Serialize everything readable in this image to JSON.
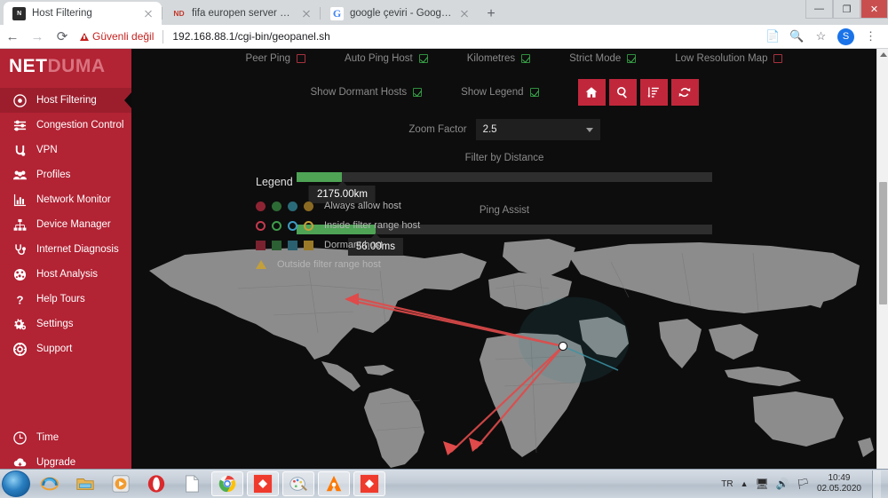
{
  "browser": {
    "tabs": [
      {
        "title": "Host Filtering",
        "favicon": "netduma-icon",
        "active": true
      },
      {
        "title": "fifa europen server problem - Co",
        "favicon": "netduma-icon",
        "active": false
      },
      {
        "title": "google çeviri - Google'da Ara",
        "favicon": "google-icon",
        "active": false
      }
    ],
    "new_tab_label": "+",
    "window_buttons": {
      "minimize": "—",
      "maximize": "❐",
      "close": "✕"
    },
    "nav": {
      "back": "←",
      "forward": "→",
      "reload": "⟳"
    },
    "security_label": "Güvenli değil",
    "url": "192.168.88.1/cgi-bin/geopanel.sh",
    "avatar_initial": "S",
    "toolbar_icons": [
      "translate-icon",
      "search-icon",
      "bookmark-star-icon",
      "menu-kebab-icon"
    ]
  },
  "sidebar": {
    "logo_primary": "NET",
    "logo_secondary": "DUMA",
    "items": [
      {
        "label": "Host Filtering",
        "icon": "target-icon",
        "active": true
      },
      {
        "label": "Congestion Control",
        "icon": "sliders-icon",
        "active": false
      },
      {
        "label": "VPN",
        "icon": "vpn-icon",
        "active": false
      },
      {
        "label": "Profiles",
        "icon": "people-icon",
        "active": false
      },
      {
        "label": "Network Monitor",
        "icon": "bar-chart-icon",
        "active": false
      },
      {
        "label": "Device Manager",
        "icon": "sitemap-icon",
        "active": false
      },
      {
        "label": "Internet Diagnosis",
        "icon": "stethoscope-icon",
        "active": false
      },
      {
        "label": "Host Analysis",
        "icon": "globe-icon",
        "active": false
      },
      {
        "label": "Help Tours",
        "icon": "question-mark-icon",
        "active": false
      },
      {
        "label": "Settings",
        "icon": "gears-icon",
        "active": false
      },
      {
        "label": "Support",
        "icon": "lifebuoy-icon",
        "active": false
      }
    ],
    "bottom_items": [
      {
        "label": "Time",
        "icon": "clock-icon"
      },
      {
        "label": "Upgrade",
        "icon": "cloud-download-icon"
      }
    ]
  },
  "controls": {
    "checkboxes_row1": [
      {
        "label": "Peer Ping",
        "checked": false
      },
      {
        "label": "Auto Ping Host",
        "checked": true
      },
      {
        "label": "Kilometres",
        "checked": true
      },
      {
        "label": "Strict Mode",
        "checked": true
      },
      {
        "label": "Low Resolution Map",
        "checked": false
      }
    ],
    "checkboxes_row2": [
      {
        "label": "Show Dormant Hosts",
        "checked": true
      },
      {
        "label": "Show Legend",
        "checked": true
      }
    ],
    "buttons": [
      {
        "name": "home-button",
        "icon": "home-icon"
      },
      {
        "name": "search-button",
        "icon": "search-icon"
      },
      {
        "name": "sort-list-button",
        "icon": "sort-list-icon"
      },
      {
        "name": "refresh-button",
        "icon": "refresh-icon"
      }
    ],
    "zoom_factor": {
      "label": "Zoom Factor",
      "value": "2.5"
    },
    "sliders": [
      {
        "title": "Filter by Distance",
        "value_label": "2175.00km",
        "fill_percent": 11
      },
      {
        "title": "Ping Assist",
        "value_label": "56.00ms",
        "fill_percent": 19
      }
    ]
  },
  "legend": {
    "title": "Legend",
    "rows": [
      {
        "label": "Always allow host",
        "style": "circle-fill",
        "colors": [
          "#8e2433",
          "#2d6b35",
          "#2a6b7a",
          "#8a6a22"
        ]
      },
      {
        "label": "Inside filter range host",
        "style": "circle-ring",
        "colors": [
          "#c43a4d",
          "#3e9c4b",
          "#3e9cc4",
          "#c4a03a"
        ]
      },
      {
        "label": "Dormant host",
        "style": "square",
        "colors": [
          "#7a2230",
          "#2c5f33",
          "#2a6070",
          "#9a7a28"
        ]
      },
      {
        "label": "Outside filter range host",
        "style": "triangle",
        "colors": [
          "#c4a03a"
        ]
      }
    ]
  },
  "map": {
    "accent_line_color": "#e04a4a",
    "filter_circle_color": "#2f7f8f",
    "land_color": "#8c8c8c",
    "host_marker": "host-marker-icon"
  },
  "taskbar": {
    "start_label": "start-orb",
    "icons": [
      {
        "name": "internet-explorer-icon"
      },
      {
        "name": "windows-explorer-icon"
      },
      {
        "name": "media-player-icon"
      },
      {
        "name": "opera-icon"
      },
      {
        "name": "document-icon"
      },
      {
        "name": "google-chrome-icon"
      },
      {
        "name": "red-diamond-app-icon"
      },
      {
        "name": "paint-icon"
      },
      {
        "name": "avast-icon"
      },
      {
        "name": "red-diamond-app-icon-2"
      }
    ],
    "tray": {
      "language": "TR",
      "icons": [
        "show-hidden-icon",
        "network-icon",
        "volume-icon",
        "action-center-icon"
      ],
      "time": "10:49",
      "date": "02.05.2020"
    }
  }
}
